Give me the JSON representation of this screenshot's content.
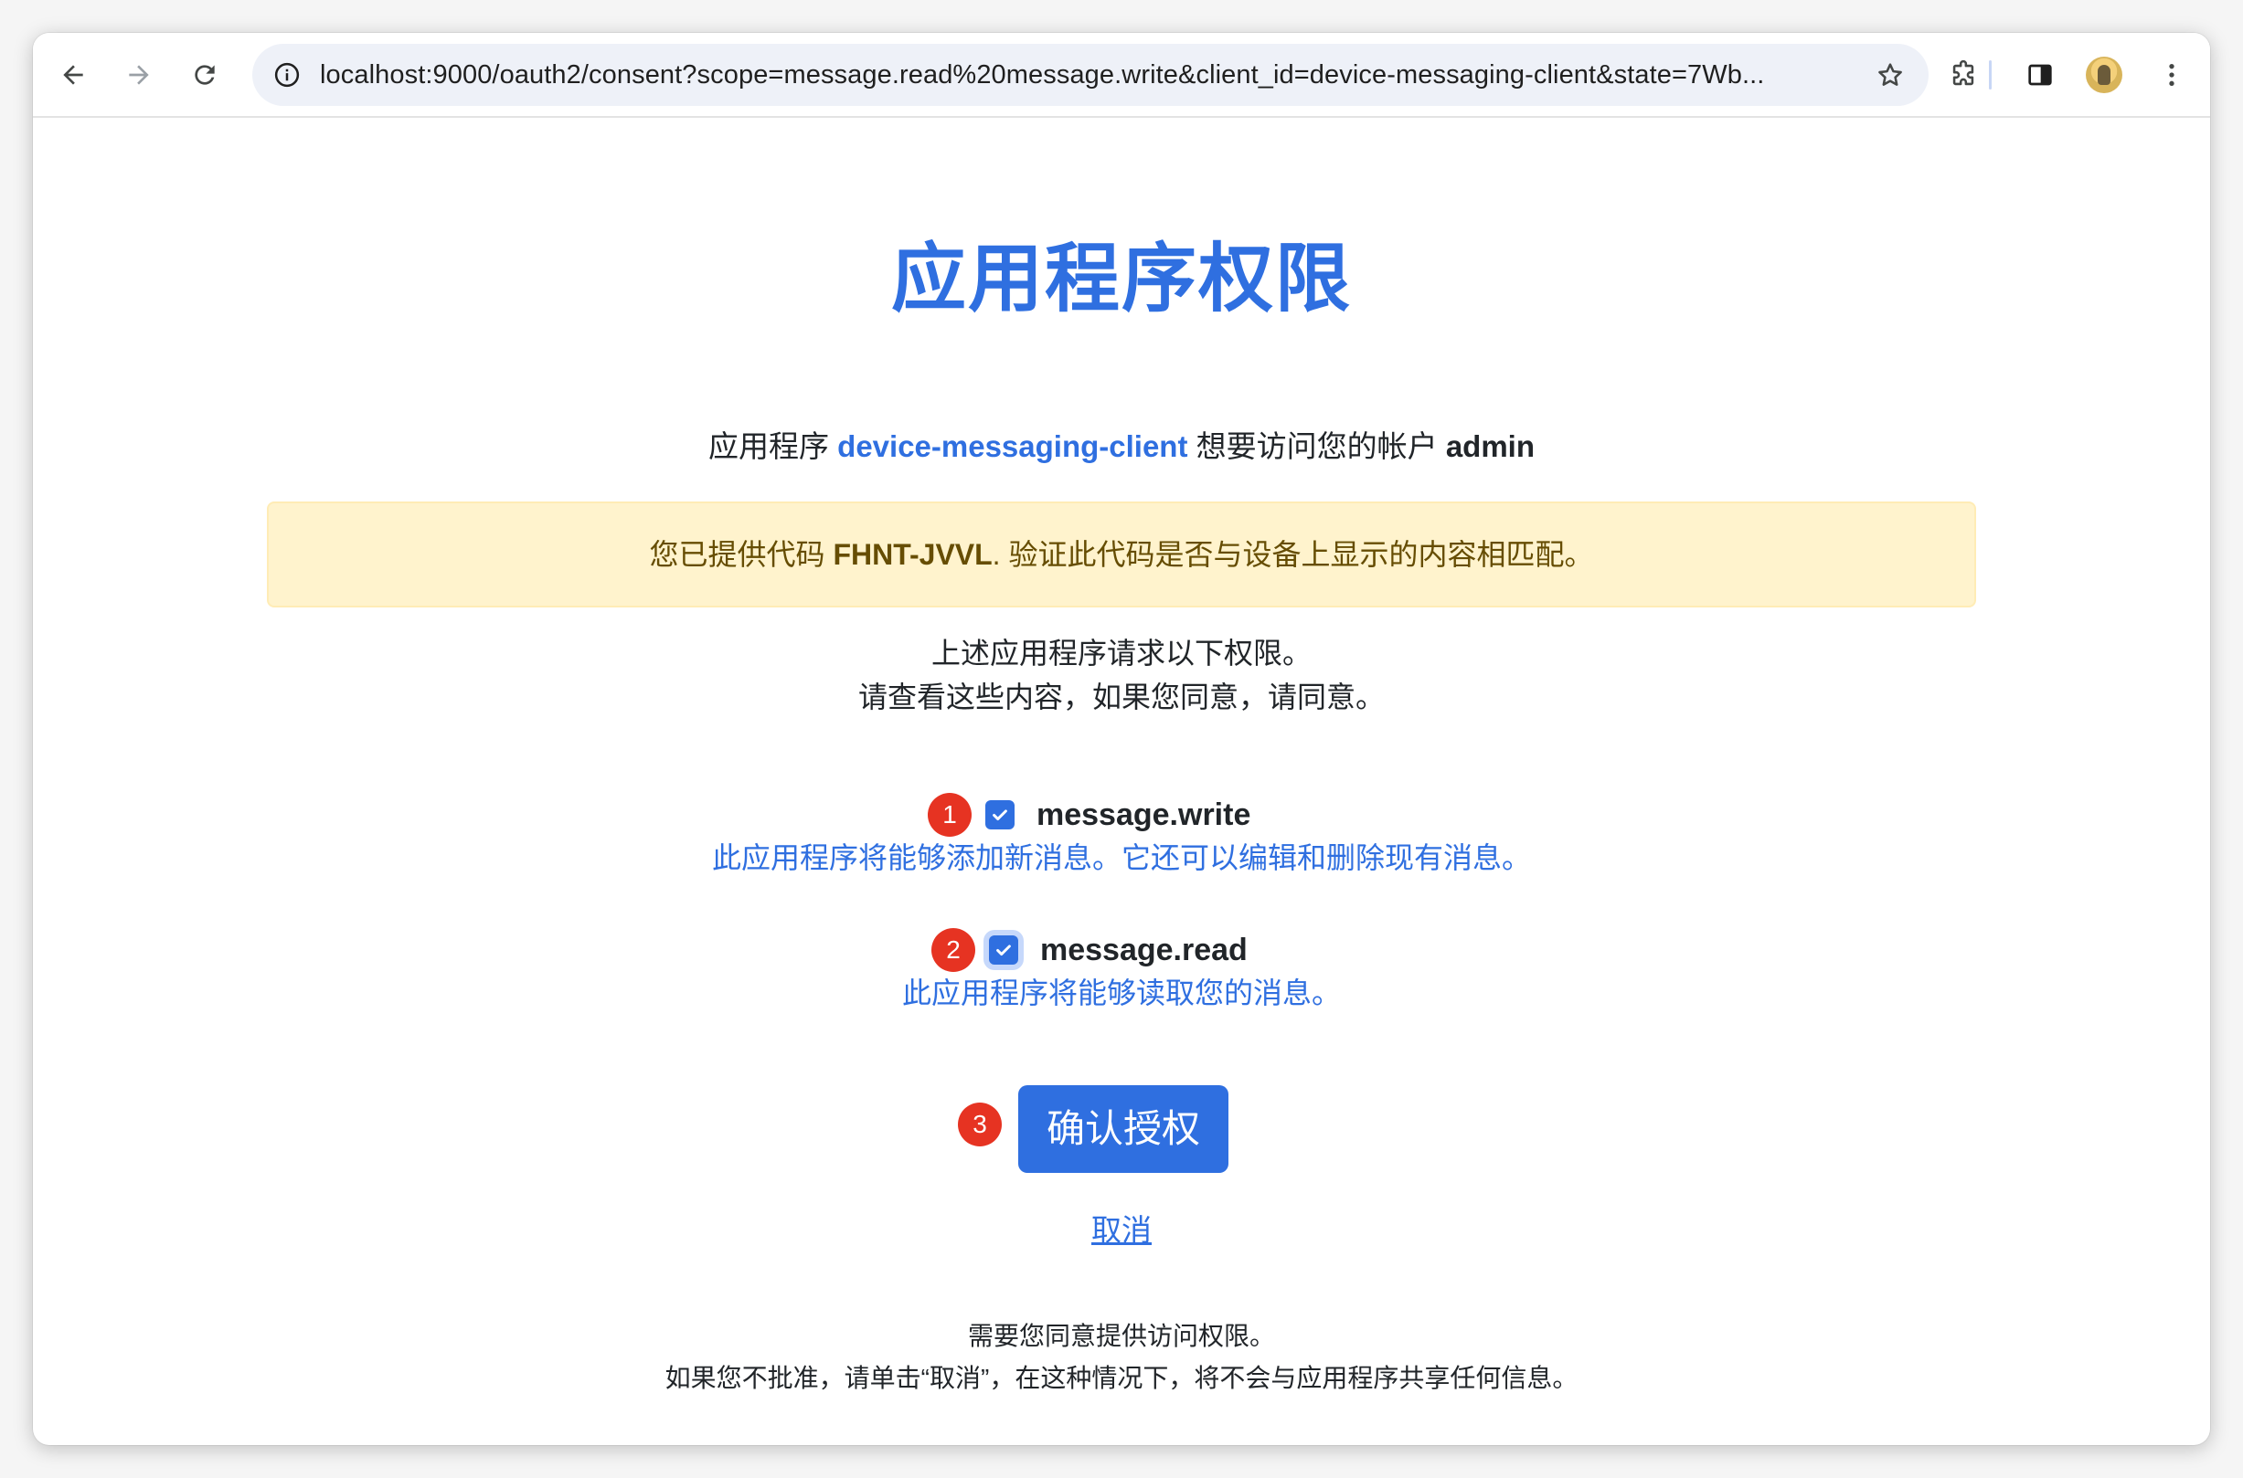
{
  "browser": {
    "url": "localhost:9000/oauth2/consent?scope=message.read%20message.write&client_id=device-messaging-client&state=7Wb..."
  },
  "page": {
    "title": "应用程序权限",
    "request_prefix": "应用程序",
    "client_id": "device-messaging-client",
    "request_middle": "想要访问您的帐户",
    "principal": "admin",
    "alert_prefix": "您已提供代码",
    "user_code": "FHNT-JVVL",
    "alert_suffix": ". 验证此代码是否与设备上显示的内容相匹配。",
    "info_line1": "上述应用程序请求以下权限。",
    "info_line2": "请查看这些内容，如果您同意，请同意。",
    "scopes": [
      {
        "badge": "1",
        "name": "message.write",
        "checked": true,
        "description": "此应用程序将能够添加新消息。它还可以编辑和删除现有消息。"
      },
      {
        "badge": "2",
        "name": "message.read",
        "checked": true,
        "description": "此应用程序将能够读取您的消息。"
      }
    ],
    "submit_badge": "3",
    "submit_label": "确认授权",
    "cancel_label": "取消",
    "footer_line1": "需要您同意提供访问权限。",
    "footer_line2": "如果您不批准，请单击“取消”，在这种情况下，将不会与应用程序共享任何信息。"
  },
  "colors": {
    "primary": "#2f6fe0",
    "badge": "#e63322",
    "alert_bg": "#fff3cd",
    "alert_text": "#664d03"
  },
  "icons": [
    "back-arrow-icon",
    "forward-arrow-icon",
    "reload-icon",
    "info-icon",
    "star-icon",
    "extensions-icon",
    "side-panel-icon",
    "kebab-menu-icon",
    "check-icon"
  ]
}
